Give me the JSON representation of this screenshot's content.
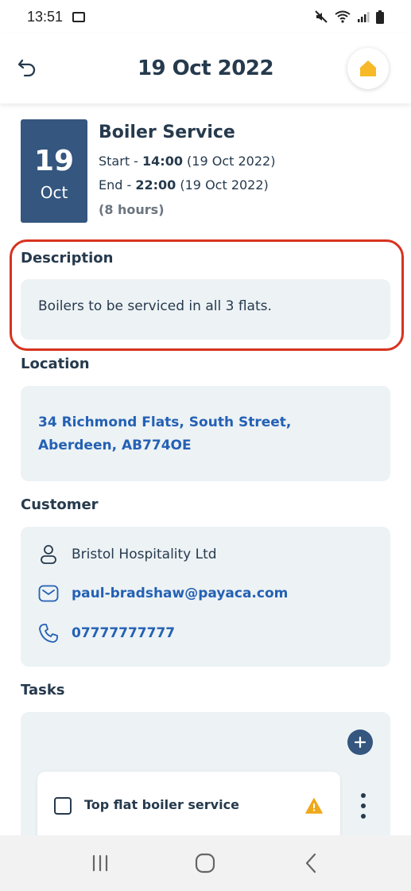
{
  "status_bar": {
    "time": "13:51"
  },
  "header": {
    "title": "19 Oct 2022"
  },
  "event": {
    "day": "19",
    "month": "Oct",
    "title": "Boiler Service",
    "start_label": "Start - ",
    "start_time": "14:00",
    "start_date": " (19 Oct 2022)",
    "end_label": "End - ",
    "end_time": "22:00",
    "end_date": " (19 Oct 2022)",
    "duration": "(8 hours)"
  },
  "description": {
    "heading": "Description",
    "text": "Boilers to be serviced in all 3 flats."
  },
  "location": {
    "heading": "Location",
    "line1": "34 Richmond Flats, South Street,",
    "line2": "Aberdeen, AB774OE"
  },
  "customer": {
    "heading": "Customer",
    "name": "Bristol Hospitality Ltd",
    "email": "paul-bradshaw@payaca.com",
    "phone": "07777777777"
  },
  "tasks": {
    "heading": "Tasks",
    "items": [
      {
        "name": "Top flat boiler service"
      }
    ]
  },
  "colors": {
    "brand_navy": "#263a4d",
    "date_block": "#34567f",
    "link_blue": "#2461b4",
    "highlight_red": "#d7331f",
    "home_icon": "#f7b928",
    "warning": "#f0a81b"
  },
  "icons": {
    "back": "undo-arrow-icon",
    "home": "home-icon",
    "person": "person-icon",
    "email": "envelope-icon",
    "phone": "phone-icon",
    "add": "plus-icon",
    "warning": "warning-triangle-icon",
    "more": "kebab-menu-icon"
  }
}
